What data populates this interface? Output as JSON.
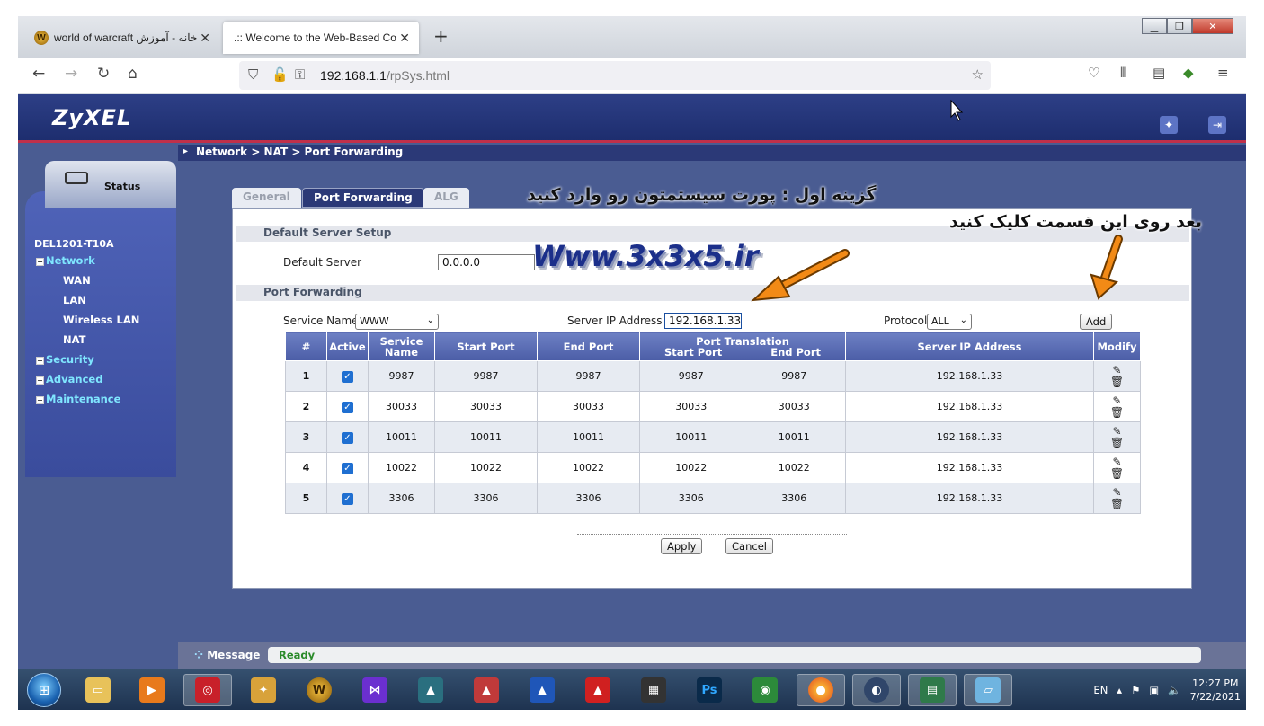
{
  "browser": {
    "tabs": [
      {
        "label": "خانه - آموزش world of warcraft",
        "active": false
      },
      {
        "label": ".:: Welcome to the Web-Based Conf",
        "active": true
      }
    ],
    "url_host": "192.168.1.1",
    "url_path": "/rpSys.html"
  },
  "header": {
    "logo": "ZyXEL"
  },
  "breadcrumb": "Network > NAT > Port Forwarding",
  "sidebar": {
    "status_label": "Status",
    "device": "DEL1201-T10A",
    "network": "Network",
    "network_items": [
      "WAN",
      "LAN",
      "Wireless LAN",
      "NAT"
    ],
    "security": "Security",
    "advanced": "Advanced",
    "maintenance": "Maintenance"
  },
  "page_tabs": {
    "general": "General",
    "port_forwarding": "Port Forwarding",
    "alg": "ALG"
  },
  "default_server": {
    "section_title": "Default Server Setup",
    "label": "Default Server",
    "value": "0.0.0.0"
  },
  "port_forwarding": {
    "section_title": "Port Forwarding",
    "service_name_label": "Service Name",
    "service_name_value": "WWW",
    "server_ip_label": "Server IP Address",
    "server_ip_value": "192.168.1.33",
    "protocol_label": "Protocol",
    "protocol_value": "ALL",
    "add_label": "Add"
  },
  "table": {
    "headers": {
      "num": "#",
      "active": "Active",
      "service_name": "Service Name",
      "start_port": "Start Port",
      "end_port": "End Port",
      "translation": "Port Translation",
      "tr_start": "Start Port",
      "tr_end": "End Port",
      "server_ip": "Server IP Address",
      "modify": "Modify"
    },
    "rows": [
      {
        "num": "1",
        "service": "9987",
        "start": "9987",
        "end": "9987",
        "tstart": "9987",
        "tend": "9987",
        "ip": "192.168.1.33"
      },
      {
        "num": "2",
        "service": "30033",
        "start": "30033",
        "end": "30033",
        "tstart": "30033",
        "tend": "30033",
        "ip": "192.168.1.33"
      },
      {
        "num": "3",
        "service": "10011",
        "start": "10011",
        "end": "10011",
        "tstart": "10011",
        "tend": "10011",
        "ip": "192.168.1.33"
      },
      {
        "num": "4",
        "service": "10022",
        "start": "10022",
        "end": "10022",
        "tstart": "10022",
        "tend": "10022",
        "ip": "192.168.1.33"
      },
      {
        "num": "5",
        "service": "3306",
        "start": "3306",
        "end": "3306",
        "tstart": "3306",
        "tend": "3306",
        "ip": "192.168.1.33"
      }
    ]
  },
  "actions": {
    "apply": "Apply",
    "cancel": "Cancel"
  },
  "message": {
    "label": "Message",
    "text": "Ready"
  },
  "annotations": {
    "first": "گزینه اول : پورت سیستمتون رو وارد کنید",
    "second": "بعد روی این قسمت کلیک کنید",
    "watermark": "Www.3x3x5.ir"
  },
  "taskbar": {
    "lang": "EN",
    "time": "12:27 PM",
    "date": "7/22/2021"
  },
  "colors": {
    "header_blue": "#1d2d6e",
    "accent_red": "#c0304a",
    "table_header": "#4b5da6",
    "arrow_orange": "#f28a16"
  }
}
